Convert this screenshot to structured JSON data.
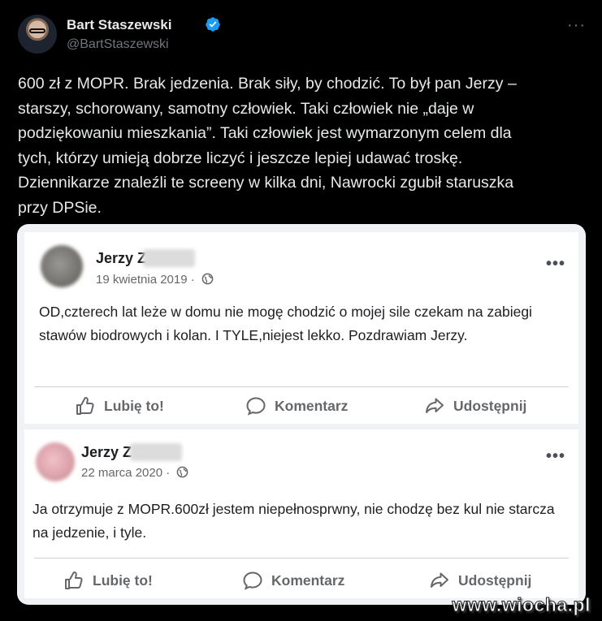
{
  "tweet": {
    "author_name": "Bart Staszewski",
    "handle": "@BartStaszewski",
    "more_label": "···",
    "text": "600 zł z MOPR. Brak jedzenia. Brak siły, by chodzić. To był pan Jerzy –\nstarszy, schorowany, samotny człowiek. Taki człowiek nie „daje w\npodziękowaniu mieszkania”. Taki człowiek jest wymarzonym celem dla\ntych, którzy umieją dobrze liczyć i jeszcze lepiej udawać troskę.\nDziennikarze znaleźli te screeny w kilka dni, Nawrocki zgubił staruszka\nprzy DPSie.",
    "verified_color": "#1d9bf0"
  },
  "fb_posts": [
    {
      "author": "Jerzy Z",
      "date": "19 kwietnia 2019 ·",
      "text": "OD,czterech lat leże w domu nie mogę chodzić o mojej sile czekam na zabiegi stawów biodrowych i kolan. I TYLE,niejest lekko. Pozdrawiam Jerzy.",
      "more_label": "•••",
      "actions": {
        "like": "Lubię to!",
        "comment": "Komentarz",
        "share": "Udostępnij"
      }
    },
    {
      "author": "Jerzy Z",
      "date": "22 marca 2020 ·",
      "text": "Ja otrzymuje z MOPR.600zł jestem niepełnosprwny, nie chodzę bez kul nie starcza na jedzenie, i tyle.",
      "more_label": "•••",
      "actions": {
        "like": "Lubię to!",
        "comment": "Komentarz",
        "share": "Udostępnij"
      }
    }
  ],
  "watermark": "www.wiocha.pl",
  "icons": [
    "verified-badge-icon",
    "globe-icon",
    "like-icon",
    "comment-icon",
    "share-icon"
  ]
}
